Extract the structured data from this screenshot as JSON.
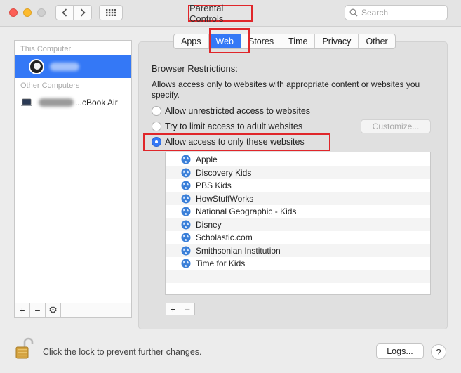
{
  "window": {
    "title": "Parental Controls",
    "search_placeholder": "Search"
  },
  "sidebar": {
    "header_this": "This Computer",
    "header_other": "Other Computers",
    "other_computer_label": "...cBook Air",
    "toolbar": {
      "add": "+",
      "remove": "−",
      "gear": "⚙"
    }
  },
  "tabs": [
    "Apps",
    "Web",
    "Stores",
    "Time",
    "Privacy",
    "Other"
  ],
  "active_tab": "Web",
  "web": {
    "section_title": "Browser Restrictions:",
    "description": "Allows access only to websites with appropriate content or websites you specify.",
    "options": [
      "Allow unrestricted access to websites",
      "Try to limit access to adult websites",
      "Allow access to only these websites"
    ],
    "selected_option": 2,
    "customize_label": "Customize...",
    "sites": [
      "Apple",
      "Discovery Kids",
      "PBS Kids",
      "HowStuffWorks",
      "National Geographic - Kids",
      "Disney",
      "Scholastic.com",
      "Smithsonian Institution",
      "Time for Kids"
    ],
    "list_add": "+",
    "list_remove": "−"
  },
  "footer": {
    "lock_text": "Click the lock to prevent further changes.",
    "logs_label": "Logs...",
    "help_label": "?"
  },
  "colors": {
    "accent": "#3478f6",
    "highlight": "#e0262a"
  }
}
